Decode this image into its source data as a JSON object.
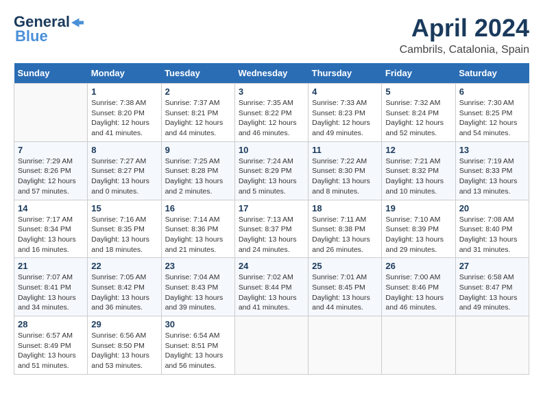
{
  "header": {
    "logo_line1": "General",
    "logo_line2": "Blue",
    "title": "April 2024",
    "subtitle": "Cambrils, Catalonia, Spain"
  },
  "days_of_week": [
    "Sunday",
    "Monday",
    "Tuesday",
    "Wednesday",
    "Thursday",
    "Friday",
    "Saturday"
  ],
  "weeks": [
    [
      {
        "day": "",
        "info": ""
      },
      {
        "day": "1",
        "info": "Sunrise: 7:38 AM\nSunset: 8:20 PM\nDaylight: 12 hours\nand 41 minutes."
      },
      {
        "day": "2",
        "info": "Sunrise: 7:37 AM\nSunset: 8:21 PM\nDaylight: 12 hours\nand 44 minutes."
      },
      {
        "day": "3",
        "info": "Sunrise: 7:35 AM\nSunset: 8:22 PM\nDaylight: 12 hours\nand 46 minutes."
      },
      {
        "day": "4",
        "info": "Sunrise: 7:33 AM\nSunset: 8:23 PM\nDaylight: 12 hours\nand 49 minutes."
      },
      {
        "day": "5",
        "info": "Sunrise: 7:32 AM\nSunset: 8:24 PM\nDaylight: 12 hours\nand 52 minutes."
      },
      {
        "day": "6",
        "info": "Sunrise: 7:30 AM\nSunset: 8:25 PM\nDaylight: 12 hours\nand 54 minutes."
      }
    ],
    [
      {
        "day": "7",
        "info": "Sunrise: 7:29 AM\nSunset: 8:26 PM\nDaylight: 12 hours\nand 57 minutes."
      },
      {
        "day": "8",
        "info": "Sunrise: 7:27 AM\nSunset: 8:27 PM\nDaylight: 13 hours\nand 0 minutes."
      },
      {
        "day": "9",
        "info": "Sunrise: 7:25 AM\nSunset: 8:28 PM\nDaylight: 13 hours\nand 2 minutes."
      },
      {
        "day": "10",
        "info": "Sunrise: 7:24 AM\nSunset: 8:29 PM\nDaylight: 13 hours\nand 5 minutes."
      },
      {
        "day": "11",
        "info": "Sunrise: 7:22 AM\nSunset: 8:30 PM\nDaylight: 13 hours\nand 8 minutes."
      },
      {
        "day": "12",
        "info": "Sunrise: 7:21 AM\nSunset: 8:32 PM\nDaylight: 13 hours\nand 10 minutes."
      },
      {
        "day": "13",
        "info": "Sunrise: 7:19 AM\nSunset: 8:33 PM\nDaylight: 13 hours\nand 13 minutes."
      }
    ],
    [
      {
        "day": "14",
        "info": "Sunrise: 7:17 AM\nSunset: 8:34 PM\nDaylight: 13 hours\nand 16 minutes."
      },
      {
        "day": "15",
        "info": "Sunrise: 7:16 AM\nSunset: 8:35 PM\nDaylight: 13 hours\nand 18 minutes."
      },
      {
        "day": "16",
        "info": "Sunrise: 7:14 AM\nSunset: 8:36 PM\nDaylight: 13 hours\nand 21 minutes."
      },
      {
        "day": "17",
        "info": "Sunrise: 7:13 AM\nSunset: 8:37 PM\nDaylight: 13 hours\nand 24 minutes."
      },
      {
        "day": "18",
        "info": "Sunrise: 7:11 AM\nSunset: 8:38 PM\nDaylight: 13 hours\nand 26 minutes."
      },
      {
        "day": "19",
        "info": "Sunrise: 7:10 AM\nSunset: 8:39 PM\nDaylight: 13 hours\nand 29 minutes."
      },
      {
        "day": "20",
        "info": "Sunrise: 7:08 AM\nSunset: 8:40 PM\nDaylight: 13 hours\nand 31 minutes."
      }
    ],
    [
      {
        "day": "21",
        "info": "Sunrise: 7:07 AM\nSunset: 8:41 PM\nDaylight: 13 hours\nand 34 minutes."
      },
      {
        "day": "22",
        "info": "Sunrise: 7:05 AM\nSunset: 8:42 PM\nDaylight: 13 hours\nand 36 minutes."
      },
      {
        "day": "23",
        "info": "Sunrise: 7:04 AM\nSunset: 8:43 PM\nDaylight: 13 hours\nand 39 minutes."
      },
      {
        "day": "24",
        "info": "Sunrise: 7:02 AM\nSunset: 8:44 PM\nDaylight: 13 hours\nand 41 minutes."
      },
      {
        "day": "25",
        "info": "Sunrise: 7:01 AM\nSunset: 8:45 PM\nDaylight: 13 hours\nand 44 minutes."
      },
      {
        "day": "26",
        "info": "Sunrise: 7:00 AM\nSunset: 8:46 PM\nDaylight: 13 hours\nand 46 minutes."
      },
      {
        "day": "27",
        "info": "Sunrise: 6:58 AM\nSunset: 8:47 PM\nDaylight: 13 hours\nand 49 minutes."
      }
    ],
    [
      {
        "day": "28",
        "info": "Sunrise: 6:57 AM\nSunset: 8:49 PM\nDaylight: 13 hours\nand 51 minutes."
      },
      {
        "day": "29",
        "info": "Sunrise: 6:56 AM\nSunset: 8:50 PM\nDaylight: 13 hours\nand 53 minutes."
      },
      {
        "day": "30",
        "info": "Sunrise: 6:54 AM\nSunset: 8:51 PM\nDaylight: 13 hours\nand 56 minutes."
      },
      {
        "day": "",
        "info": ""
      },
      {
        "day": "",
        "info": ""
      },
      {
        "day": "",
        "info": ""
      },
      {
        "day": "",
        "info": ""
      }
    ]
  ]
}
